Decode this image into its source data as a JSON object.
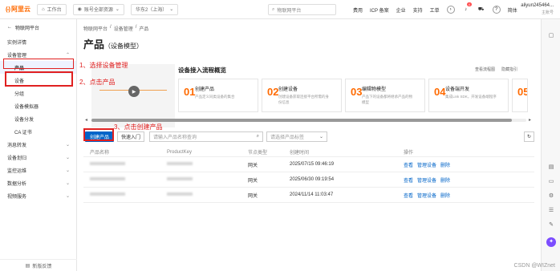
{
  "topbar": {
    "logo_text": "阿里云",
    "logo_mark": "(-)",
    "workbench": "工作台",
    "account_scope": "账号全部资源",
    "region": "华东2（上海）",
    "search_placeholder": "物联网平台",
    "links": [
      "费用",
      "ICP 备案",
      "企业",
      "支持",
      "工单"
    ],
    "notif_badge": "4",
    "lang": "简体",
    "account_name": "aliyun245464...",
    "account_sub": "主账号"
  },
  "sidebar": {
    "back_label": "物联网平台",
    "items": [
      {
        "label": "实例详情",
        "level": 0
      },
      {
        "label": "设备管理",
        "level": 0,
        "expandable": true
      },
      {
        "label": "产品",
        "level": 1,
        "active": true
      },
      {
        "label": "设备",
        "level": 1
      },
      {
        "label": "分组",
        "level": 1
      },
      {
        "label": "设备模拟器",
        "level": 1
      },
      {
        "label": "设备分发",
        "level": 1
      },
      {
        "label": "CA 证书",
        "level": 1
      },
      {
        "label": "消息转发",
        "level": 0,
        "expandable": true
      },
      {
        "label": "设备划归",
        "level": 0,
        "expandable": true
      },
      {
        "label": "监控运维",
        "level": 0,
        "expandable": true
      },
      {
        "label": "数据分析",
        "level": 0,
        "expandable": true
      },
      {
        "label": "视频服务",
        "level": 0,
        "expandable": true
      }
    ],
    "footer": "新版反馈"
  },
  "breadcrumb": [
    "物联网平台",
    "/",
    "设备管理",
    "/",
    "产品"
  ],
  "page": {
    "title": "产品",
    "subtitle": "（设备模型）"
  },
  "flow": {
    "title": "设备接入流程概览",
    "link1": "查看流程图",
    "link2": "隐藏指引",
    "cards": [
      {
        "num": "01",
        "title": "创建产品",
        "desc": "产品定义同类设备的集合"
      },
      {
        "num": "02",
        "title": "创建设备",
        "desc": "创建设备获取连接平台所需的身份信息"
      },
      {
        "num": "03",
        "title": "编辑物模型",
        "desc": "产品下的设备都将继承产品的物模型"
      },
      {
        "num": "04",
        "title": "设备端开发",
        "desc": "集成Link SDK，开发设备端程序"
      },
      {
        "num": "05",
        "title": "",
        "desc": ""
      }
    ]
  },
  "toolbar": {
    "create_label": "创建产品",
    "quickstart_label": "快速入门",
    "search_placeholder": "请输入产品名称查询",
    "tag_placeholder": "请选择产品标签"
  },
  "table": {
    "headers": [
      "产品名称",
      "ProductKey",
      "节点类型",
      "创建时间",
      "操作"
    ],
    "rows": [
      {
        "node": "网关",
        "time": "2025/07/15 09:46:19",
        "actions": [
          "查看",
          "管理设备",
          "删除"
        ]
      },
      {
        "node": "网关",
        "time": "2025/06/30 09:19:54",
        "actions": [
          "查看",
          "管理设备",
          "删除"
        ]
      },
      {
        "node": "网关",
        "time": "2024/11/14 11:03:47",
        "actions": [
          "查看",
          "管理设备",
          "删除"
        ]
      }
    ]
  },
  "annotations": {
    "step1": "1、选择设备管理",
    "step2": "2、点击产品",
    "step3": "3、点击创建产品",
    "color": "#e02020"
  },
  "watermark": "CSDN @WIZnet",
  "colors": {
    "brand": "#ff6a00",
    "primary": "#0064c8"
  }
}
